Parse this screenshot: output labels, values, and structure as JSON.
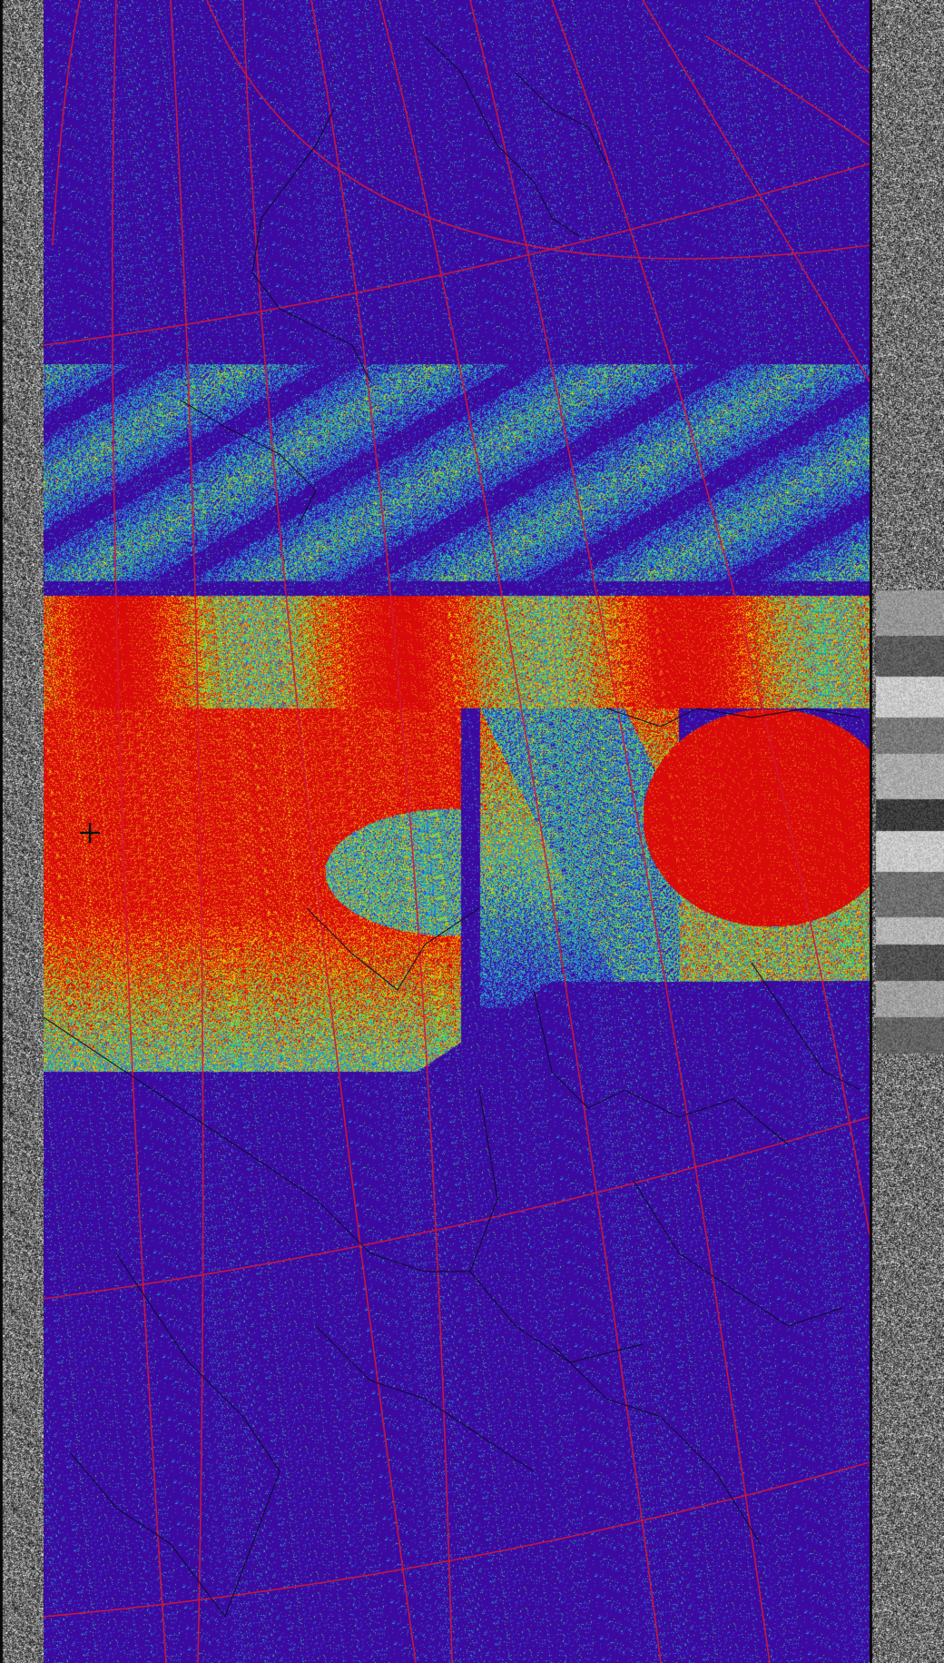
{
  "image": {
    "kind": "NOAA APT satellite image, false-color temperature enhancement",
    "palette": {
      "clear_ground": "#3c0aa0",
      "cloud_low": "#2a6be0",
      "cloud_mid": "#28c8b0",
      "cloud_high": "#e8d400",
      "cloud_cold": "#d80a0a",
      "grid": "#d0173a",
      "borders": "#0a0a28",
      "telemetry_bg": "#2a2a2a"
    },
    "markers": [
      {
        "name": "reception-location-marker",
        "symbol": "+"
      }
    ]
  }
}
